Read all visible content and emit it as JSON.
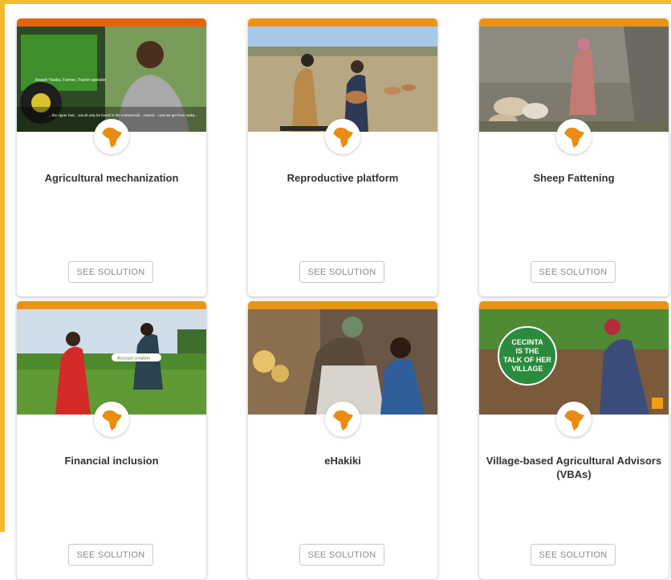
{
  "colors": {
    "accent": "#f7b92e",
    "card_bar": "#ea8c12",
    "logo": "#ea8c12"
  },
  "cards": [
    {
      "title": "Agricultural mechanization",
      "button": "SEE SOLUTION",
      "photo_caption": "Joseph Yisaka, Farmer, Tractor operator",
      "photo_subtitle": "...the ripper had... would only be found in the commercial ...owned ...now we get from Isaka..."
    },
    {
      "title": "Reproductive platform",
      "button": "SEE SOLUTION"
    },
    {
      "title": "Sheep Fattening",
      "button": "SEE SOLUTION"
    },
    {
      "title": "Financial inclusion",
      "button": "SEE SOLUTION",
      "photo_caption": "Account creation"
    },
    {
      "title": "eHakiki",
      "button": "SEE SOLUTION"
    },
    {
      "title": "Village-based Agricultural Advisors (VBAs)",
      "button": "SEE SOLUTION",
      "photo_sign": [
        "CECINTA",
        "IS THE",
        "TALK OF HER",
        "VILLAGE"
      ]
    }
  ]
}
